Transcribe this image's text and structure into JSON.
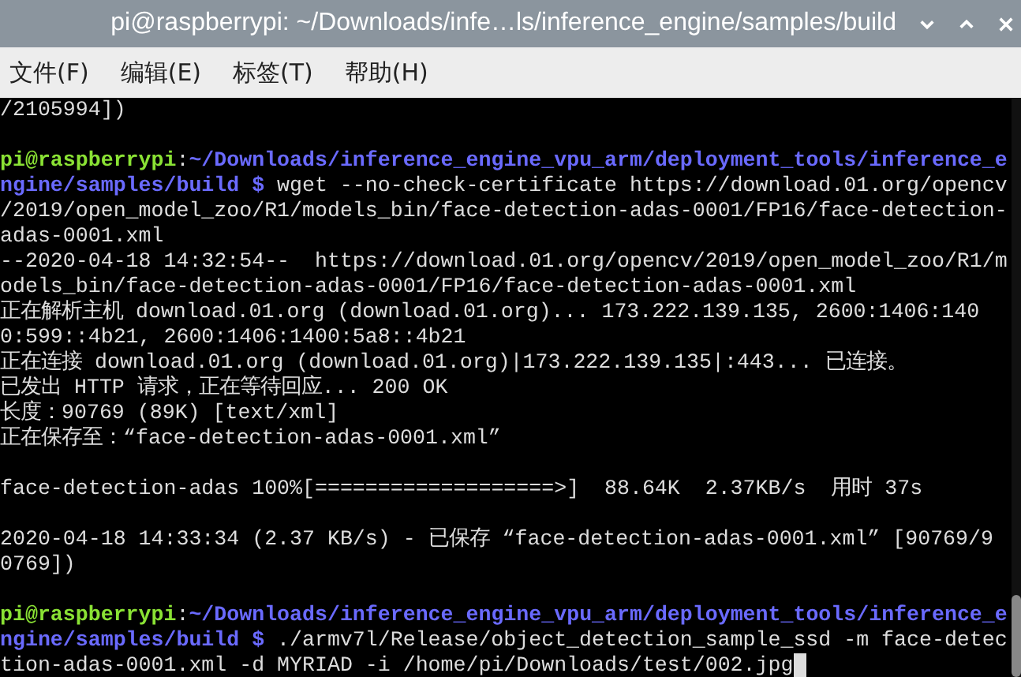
{
  "window": {
    "title": "pi@raspberrypi: ~/Downloads/infe…ls/inference_engine/samples/build"
  },
  "menu": [
    "文件(F)",
    "编辑(E)",
    "标签(T)",
    "帮助(H)"
  ],
  "terminal": {
    "lines": [
      {
        "kind": "text",
        "text": "/2105994])"
      },
      {
        "kind": "blank"
      },
      {
        "kind": "prompt",
        "user": "pi@raspberrypi",
        "colon": ":",
        "path": "~/Downloads/inference_engine_vpu_arm/deployment_tools/inference_e"
      },
      {
        "kind": "prompt",
        "path": "ngine/samples/build",
        "symbol": "$",
        "command": "wget --no-check-certificate https://download.01.org/opencv"
      },
      {
        "kind": "text",
        "text": "/2019/open_model_zoo/R1/models_bin/face-detection-adas-0001/FP16/face-detection-"
      },
      {
        "kind": "text",
        "text": "adas-0001.xml"
      },
      {
        "kind": "text",
        "text": "--2020-04-18 14:32:54--  https://download.01.org/opencv/2019/open_model_zoo/R1/m"
      },
      {
        "kind": "text",
        "text": "odels_bin/face-detection-adas-0001/FP16/face-detection-adas-0001.xml"
      },
      {
        "kind": "text",
        "text": "正在解析主机 download.01.org (download.01.org)... 173.222.139.135, 2600:1406:140"
      },
      {
        "kind": "text",
        "text": "0:599::4b21, 2600:1406:1400:5a8::4b21"
      },
      {
        "kind": "text",
        "text": "正在连接 download.01.org (download.01.org)|173.222.139.135|:443... 已连接。"
      },
      {
        "kind": "text",
        "text": "已发出 HTTP 请求，正在等待回应... 200 OK"
      },
      {
        "kind": "text",
        "text": "长度：90769 (89K) [text/xml]"
      },
      {
        "kind": "text",
        "text": "正在保存至：“face-detection-adas-0001.xml”"
      },
      {
        "kind": "blank"
      },
      {
        "kind": "text",
        "text": "face-detection-adas 100%[===================>]  88.64K  2.37KB/s  用时 37s"
      },
      {
        "kind": "blank"
      },
      {
        "kind": "text",
        "text": "2020-04-18 14:33:34 (2.37 KB/s) - 已保存 “face-detection-adas-0001.xml” [90769/9"
      },
      {
        "kind": "text",
        "text": "0769])"
      },
      {
        "kind": "blank"
      },
      {
        "kind": "prompt",
        "user": "pi@raspberrypi",
        "colon": ":",
        "path": "~/Downloads/inference_engine_vpu_arm/deployment_tools/inference_e"
      },
      {
        "kind": "prompt",
        "path": "ngine/samples/build",
        "symbol": "$",
        "command": "./armv7l/Release/object_detection_sample_ssd -m face-detec"
      },
      {
        "kind": "text",
        "text": "tion-adas-0001.xml -d MYRIAD -i /home/pi/Downloads/test/002.jpg",
        "cursor": true
      }
    ]
  }
}
